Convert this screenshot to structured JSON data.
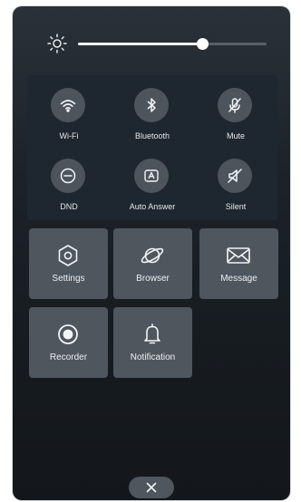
{
  "brightness": {
    "level_percent": 66
  },
  "toggles": [
    {
      "label": "Wi-Fi",
      "icon": "wifi-icon"
    },
    {
      "label": "Bluetooth",
      "icon": "bluetooth-icon"
    },
    {
      "label": "Mute",
      "icon": "mic-off-icon"
    },
    {
      "label": "DND",
      "icon": "minus-circle-icon"
    },
    {
      "label": "Auto Answer",
      "icon": "auto-answer-icon"
    },
    {
      "label": "Silent",
      "icon": "speaker-off-icon"
    }
  ],
  "apps": [
    {
      "label": "Settings",
      "icon": "hexagon-gear-icon"
    },
    {
      "label": "Browser",
      "icon": "planet-icon"
    },
    {
      "label": "Message",
      "icon": "envelope-icon"
    },
    {
      "label": "Recorder",
      "icon": "record-icon"
    },
    {
      "label": "Notification",
      "icon": "bell-icon"
    }
  ],
  "close": {
    "icon": "close-icon"
  }
}
